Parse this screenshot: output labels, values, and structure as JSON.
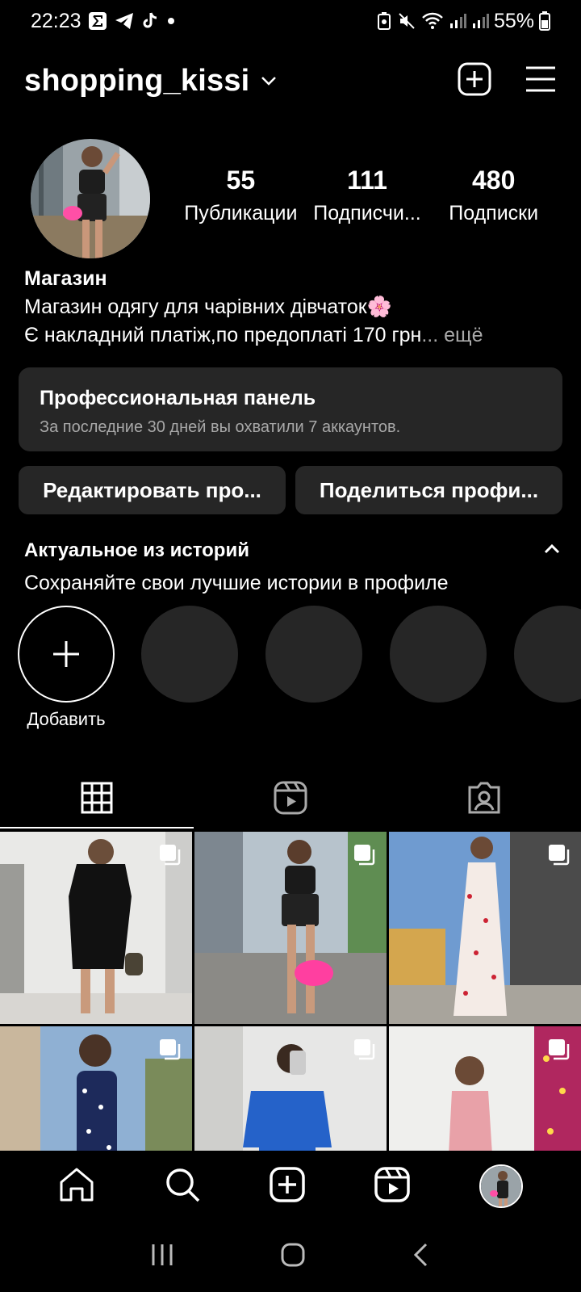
{
  "status_bar": {
    "time": "22:23",
    "battery": "55%"
  },
  "header": {
    "username": "shopping_kissi"
  },
  "profile": {
    "stats": [
      {
        "value": "55",
        "label": "Публикации"
      },
      {
        "value": "111",
        "label": "Подписчи..."
      },
      {
        "value": "480",
        "label": "Подписки"
      }
    ],
    "name": "Магазин",
    "bio_line1": "Магазин одягу для чарівних дівчаток🌸",
    "bio_line2": "Є накладний платіж,по предоплаті 170 грн",
    "bio_more": "... ещё"
  },
  "pro_panel": {
    "title": "Профессиональная панель",
    "subtitle": "За последние 30 дней вы охватили 7 аккаунтов."
  },
  "buttons": {
    "edit": "Редактировать про...",
    "share": "Поделиться профи..."
  },
  "highlights": {
    "title": "Актуальное из историй",
    "subtitle": "Сохраняйте свои лучшие истории в профиле",
    "add_label": "Добавить"
  },
  "tabs": [
    "grid-icon",
    "reels-icon",
    "tagged-icon"
  ],
  "colors": {
    "background": "#000000",
    "surface": "#262626",
    "secondary_text": "#a8a8a8"
  }
}
